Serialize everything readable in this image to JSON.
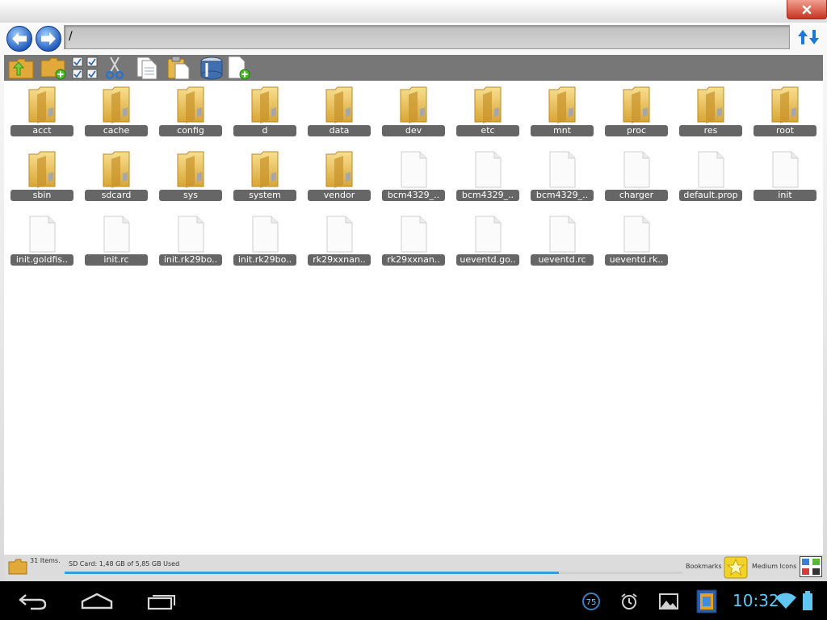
{
  "window": {
    "close_label": "close",
    "path": "/"
  },
  "toolbar": {
    "icons": [
      "up-folder-icon",
      "new-folder-icon",
      "multi-select-icon",
      "cut-icon",
      "copy-icon",
      "paste-icon",
      "zip-icon",
      "new-file-icon"
    ]
  },
  "items": [
    {
      "name": "acct",
      "type": "folder"
    },
    {
      "name": "cache",
      "type": "folder"
    },
    {
      "name": "config",
      "type": "folder"
    },
    {
      "name": "d",
      "type": "folder"
    },
    {
      "name": "data",
      "type": "folder"
    },
    {
      "name": "dev",
      "type": "folder"
    },
    {
      "name": "etc",
      "type": "folder"
    },
    {
      "name": "mnt",
      "type": "folder"
    },
    {
      "name": "proc",
      "type": "folder"
    },
    {
      "name": "res",
      "type": "folder"
    },
    {
      "name": "root",
      "type": "folder"
    },
    {
      "name": "sbin",
      "type": "folder"
    },
    {
      "name": "sdcard",
      "type": "folder"
    },
    {
      "name": "sys",
      "type": "folder"
    },
    {
      "name": "system",
      "type": "folder"
    },
    {
      "name": "vendor",
      "type": "folder"
    },
    {
      "name": "bcm4329_..",
      "type": "file"
    },
    {
      "name": "bcm4329_..",
      "type": "file"
    },
    {
      "name": "bcm4329_..",
      "type": "file"
    },
    {
      "name": "charger",
      "type": "file"
    },
    {
      "name": "default.prop",
      "type": "file"
    },
    {
      "name": "init",
      "type": "file"
    },
    {
      "name": "init.goldfis..",
      "type": "file"
    },
    {
      "name": "init.rc",
      "type": "file"
    },
    {
      "name": "init.rk29bo..",
      "type": "file"
    },
    {
      "name": "init.rk29bo..",
      "type": "file"
    },
    {
      "name": "rk29xxnan..",
      "type": "file"
    },
    {
      "name": "rk29xxnan..",
      "type": "file"
    },
    {
      "name": "ueventd.go..",
      "type": "file"
    },
    {
      "name": "ueventd.rc",
      "type": "file"
    },
    {
      "name": "ueventd.rk..",
      "type": "file"
    }
  ],
  "status": {
    "item_count": "31 Items.",
    "sd_card": "SD Card: 1,48 GB of 5,85 GB Used",
    "usage_fraction": 0.8,
    "bookmarks_label": "Bookmarks",
    "view_mode_label": "Medium Icons"
  },
  "system_bar": {
    "clock": "10:32",
    "notification_count": "75"
  },
  "colors": {
    "accent": "#3c9ad8",
    "label_bg": "#666666",
    "close_red": "#c83422",
    "clock": "#5ec6f0"
  }
}
